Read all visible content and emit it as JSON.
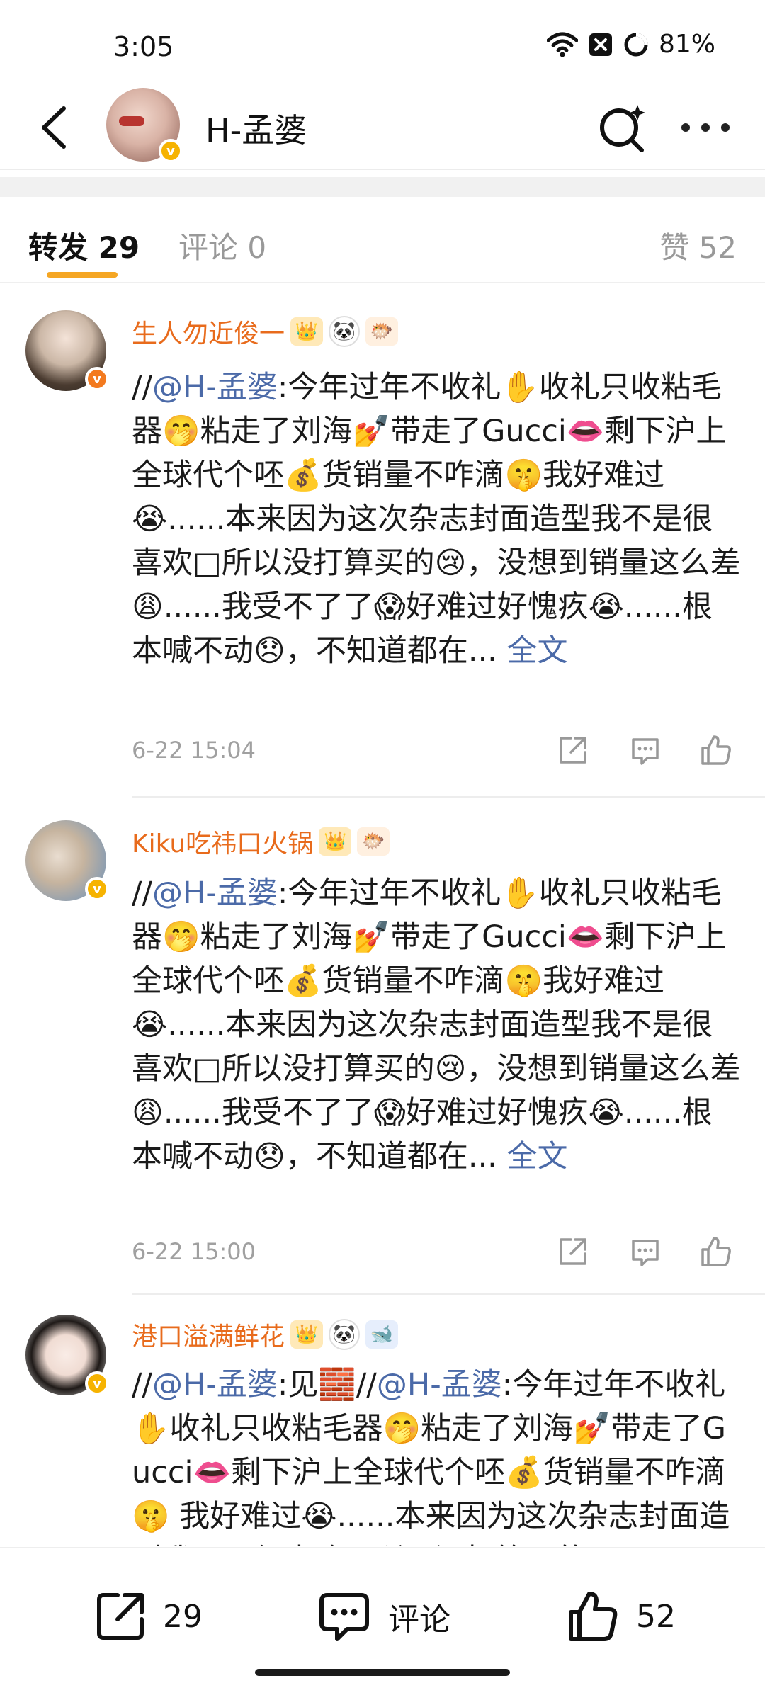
{
  "status_bar": {
    "time": "3:05",
    "battery": "81%",
    "icons": [
      "wifi-icon",
      "sim-off-icon",
      "battery-ring-icon"
    ]
  },
  "header": {
    "title": "H-孟婆",
    "icons": [
      "back-arrow-icon",
      "search-sparkle-icon",
      "more-dots-icon"
    ]
  },
  "tabs": {
    "reposts": "转发 29",
    "comments": "评论 0",
    "likes": "赞 52"
  },
  "posts": [
    {
      "username": "生人勿近俊一",
      "badges": [
        "👑",
        "🐼",
        "🐡"
      ],
      "prefix": "//",
      "mention": "@H-孟婆",
      "body": ":今年过年不收礼✋收礼只收粘毛器🤭粘走了刘海💅带走了Gucci👄剩下沪上全球代个呸💰货销量不咋滴🤫我好难过😭......本来因为这次杂志封面造型我不是很喜欢□所以没打算买的😢，没想到销量这么差😩......我受不了了😱好难过好愧疚😭......根本喊不动😞，不知道都在...",
      "full_text": "全文",
      "time": "6-22 15:04"
    },
    {
      "username": "Kiku吃祎口火锅",
      "badges": [
        "👑",
        "🐡"
      ],
      "prefix": "//",
      "mention": "@H-孟婆",
      "body": ":今年过年不收礼✋收礼只收粘毛器🤭粘走了刘海💅带走了Gucci👄剩下沪上全球代个呸💰货销量不咋滴🤫我好难过😭......本来因为这次杂志封面造型我不是很喜欢□所以没打算买的😢，没想到销量这么差😩......我受不了了😱好难过好愧疚😭......根本喊不动😞，不知道都在...",
      "full_text": "全文",
      "time": "6-22 15:00"
    },
    {
      "username": "港口溢满鲜花",
      "badges": [
        "👑",
        "🐼",
        "🐋"
      ],
      "prefix": "//",
      "mention": "@H-孟婆",
      "mid": ":见🧱//",
      "mention2": "@H-孟婆",
      "body": ":今年过年不收礼✋收礼只收粘毛器🤭粘走了刘海💅带走了Gucci👄剩下沪上全球代个呸💰货销量不咋滴🤫 我好难过😭......本来因为这次杂志封面造型我不是很喜欢□所以没打算买的"
    }
  ],
  "bottom_bar": {
    "repost_count": "29",
    "comment_label": "评论",
    "like_count": "52"
  }
}
